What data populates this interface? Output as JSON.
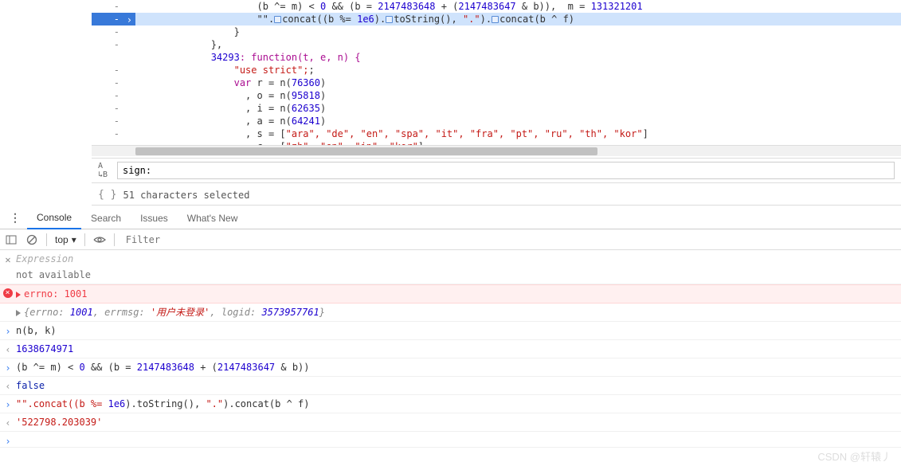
{
  "code": {
    "line1_pre": "(b ^= m) < ",
    "line1_zero": "0",
    "line1_mid": " && (b = ",
    "line1_n1": "2147483648",
    "line1_plus": " + (",
    "line1_n2": "2147483647",
    "line1_post": " & b)),  m = ",
    "line1_m": "131321201",
    "line2_pre": "\"\".",
    "line2_concat1": "concat((b %= ",
    "line2_1e6": "1e6",
    "line2_mid": ").",
    "line2_tostr": "toString(), ",
    "line2_dot": "\".\"",
    "line2_post": ").",
    "line2_concat2": "concat",
    "line2_end": "(b ^ f)",
    "brace1": "}",
    "brace2": "},",
    "modnum": "34293",
    "func": ": function(t, e, n) {",
    "usestrict": "\"use strict\";",
    "varr": "var",
    "r": " r = n(",
    "rn": "76360",
    "o": "  , o = n(",
    "on": "95818",
    "i": "  , i = n(",
    "in": "62635",
    "a": "  , a = n(",
    "an": "64241",
    "s": "  , s = [",
    "sarr": "\"ara\", \"de\", \"en\", \"spa\", \"it\", \"fra\", \"pt\", \"ru\", \"th\", \"kor\"",
    "c": "  , c = [",
    "carr": "\"zh\", \"en\", \"jp\", \"kor\""
  },
  "search": {
    "value": "sign:"
  },
  "status": {
    "text": "51 characters selected"
  },
  "tabs": {
    "console": "Console",
    "search": "Search",
    "issues": "Issues",
    "whatsnew": "What's New"
  },
  "toolbar": {
    "top": "top",
    "filter_placeholder": "Filter"
  },
  "expr": {
    "label": "Expression",
    "val": "not available"
  },
  "lines": {
    "err": "errno: 1001",
    "obj_pre": "{errno: ",
    "obj_errno": "1001",
    "obj_msg_key": ", errmsg: ",
    "obj_msg": "'用户未登录'",
    "obj_log_key": ", logid: ",
    "obj_logid": "3573957761",
    "obj_suf": "}",
    "nbk": "n(b, k)",
    "nbk_res": "1638674971",
    "expr2": "(b ^= m) < ",
    "expr2_zero": "0",
    "expr2_mid": " && (b = ",
    "expr2_n1": "2147483648",
    "expr2_plus": " + (",
    "expr2_n2": "2147483647",
    "expr2_end": " & b))",
    "false": "false",
    "expr3": "\"\".concat((b %= ",
    "expr3_1e6": "1e6",
    "expr3_mid": ").toString(), ",
    "expr3_dot": "\".\"",
    "expr3_end": ").concat(b ^ f)",
    "res3": "'522798.203039'"
  },
  "watermark": "CSDN @轩辕丿"
}
